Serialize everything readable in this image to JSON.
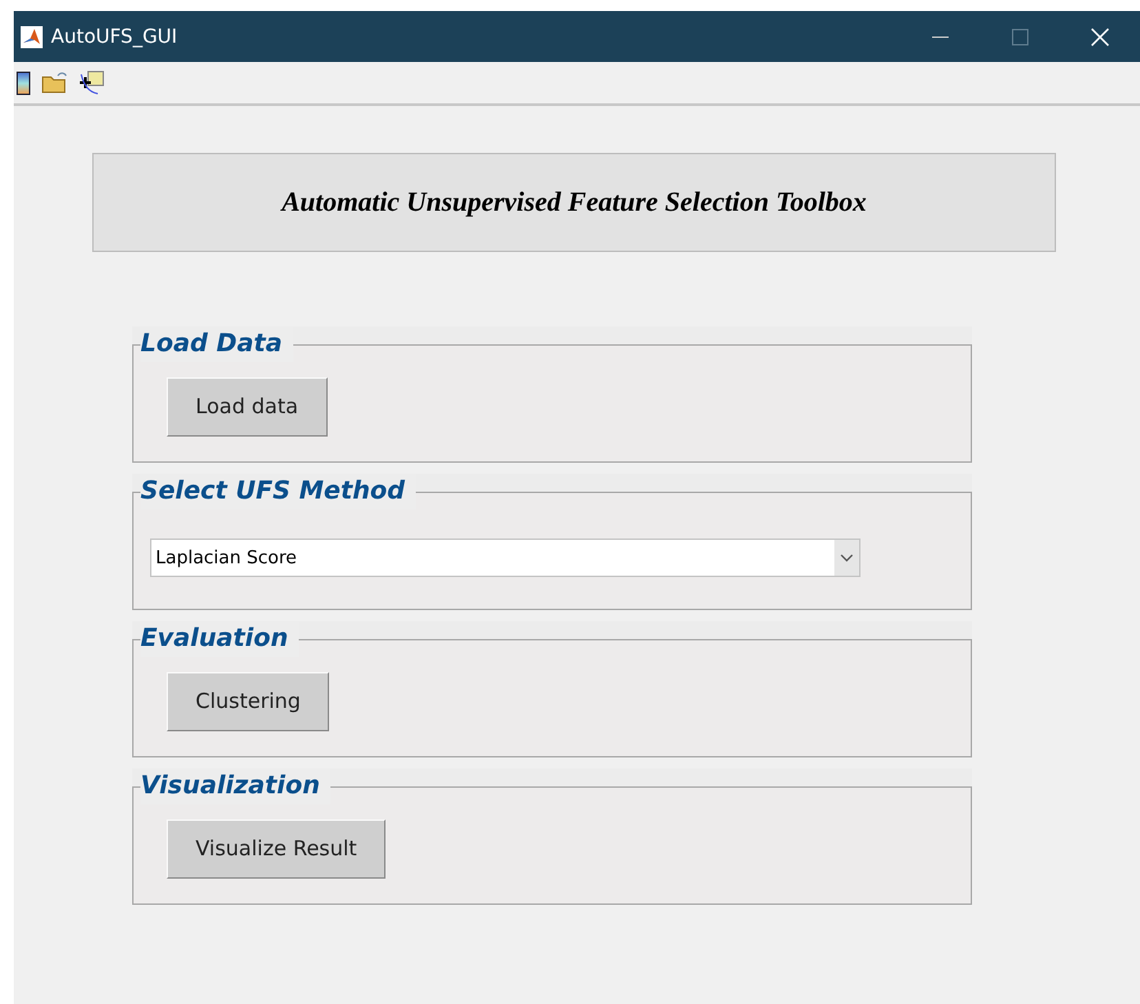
{
  "window": {
    "title": "AutoUFS_GUI"
  },
  "header": {
    "title": "Automatic Unsupervised Feature Selection Toolbox"
  },
  "panels": [
    {
      "title": "Load Data",
      "kind": "button",
      "label": "Load data"
    },
    {
      "title": "Select UFS Method",
      "kind": "dropdown",
      "value": "Laplacian Score"
    },
    {
      "title": "Evaluation",
      "kind": "button",
      "label": "Clustering"
    },
    {
      "title": "Visualization",
      "kind": "button",
      "label": "Visualize Result"
    }
  ]
}
